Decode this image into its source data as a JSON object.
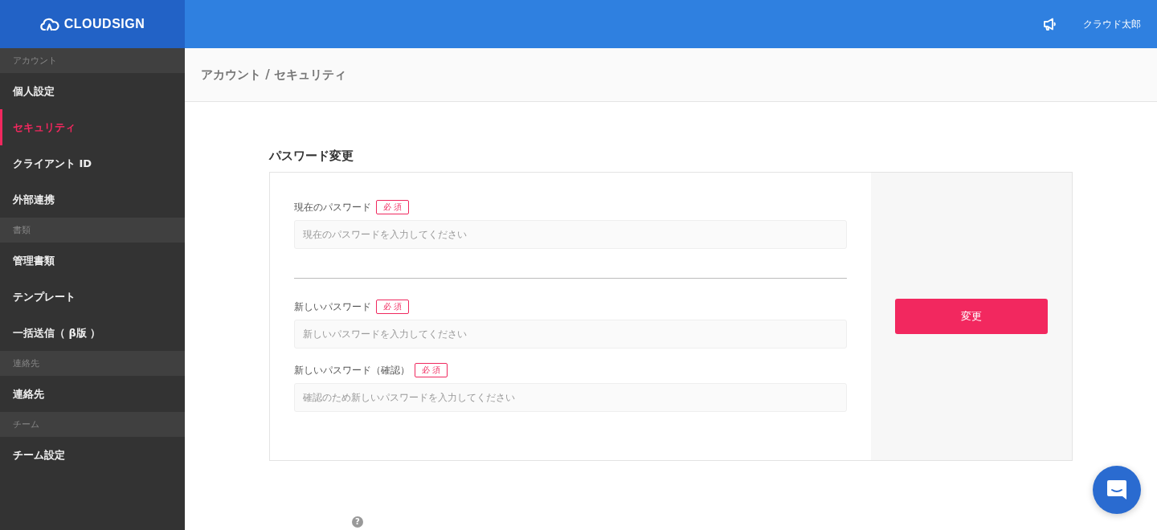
{
  "header": {
    "logo": "CLOUDSIGN",
    "user_name": "クラウド太郎"
  },
  "sidebar": {
    "sections": [
      {
        "title": "アカウント",
        "items": [
          {
            "label": "個人設定",
            "selected": false
          },
          {
            "label": "セキュリティ",
            "selected": true
          },
          {
            "label": "クライアント ID",
            "selected": false
          },
          {
            "label": "外部連携",
            "selected": false
          }
        ]
      },
      {
        "title": "書類",
        "items": [
          {
            "label": "管理書類",
            "selected": false
          },
          {
            "label": "テンプレート",
            "selected": false
          },
          {
            "label": "一括送信（ β版 ）",
            "selected": false
          }
        ]
      },
      {
        "title": "連絡先",
        "items": [
          {
            "label": "連絡先",
            "selected": false
          }
        ]
      },
      {
        "title": "チーム",
        "items": [
          {
            "label": "チーム設定",
            "selected": false
          }
        ]
      }
    ]
  },
  "breadcrumb": "アカウント / セキュリティ",
  "section_title": "パスワード変更",
  "fields": [
    {
      "label": "現在のパスワード",
      "badge": "必 須",
      "placeholder": "現在のパスワードを入力してください",
      "divider_after": true
    },
    {
      "label": "新しいパスワード",
      "badge": "必 須",
      "placeholder": "新しいパスワードを入力してください",
      "divider_after": false
    },
    {
      "label": "新しいパスワード（確認）",
      "badge": "必 須",
      "placeholder": "確認のため新しいパスワードを入力してください",
      "divider_after": false
    }
  ],
  "submit_button": "変更",
  "help_mark": "?"
}
